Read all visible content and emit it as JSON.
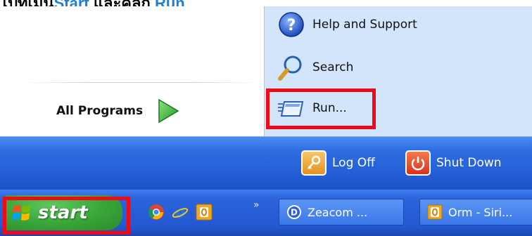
{
  "caption": {
    "prefix": "ไปที่เมนู",
    "start_word": "Start",
    "middle": " และคลิก ",
    "run_word": "Run"
  },
  "start_menu": {
    "all_programs_label": "All Programs",
    "right_items": [
      {
        "label": "Help and Support",
        "icon": "help-icon"
      },
      {
        "label": "Search",
        "icon": "search-icon"
      },
      {
        "label": "Run...",
        "icon": "run-icon"
      }
    ],
    "log_off_label": "Log Off",
    "shut_down_label": "Shut Down"
  },
  "taskbar": {
    "start_label": "start",
    "quick_launch": [
      "chrome-icon",
      "internet-explorer-icon",
      "outlook-icon"
    ],
    "overflow": "»",
    "tasks": [
      {
        "label": "Zeacom ...",
        "icon": "zeacom-icon"
      },
      {
        "label": "Orm - Siri...",
        "icon": "outlook-icon"
      }
    ]
  },
  "colors": {
    "highlight": "#ef0b15",
    "accent_text": "#1e7fd4",
    "menu_right": "#d3e5fa",
    "taskbar_blue": "#2458d2",
    "start_green": "#3aa63a"
  }
}
